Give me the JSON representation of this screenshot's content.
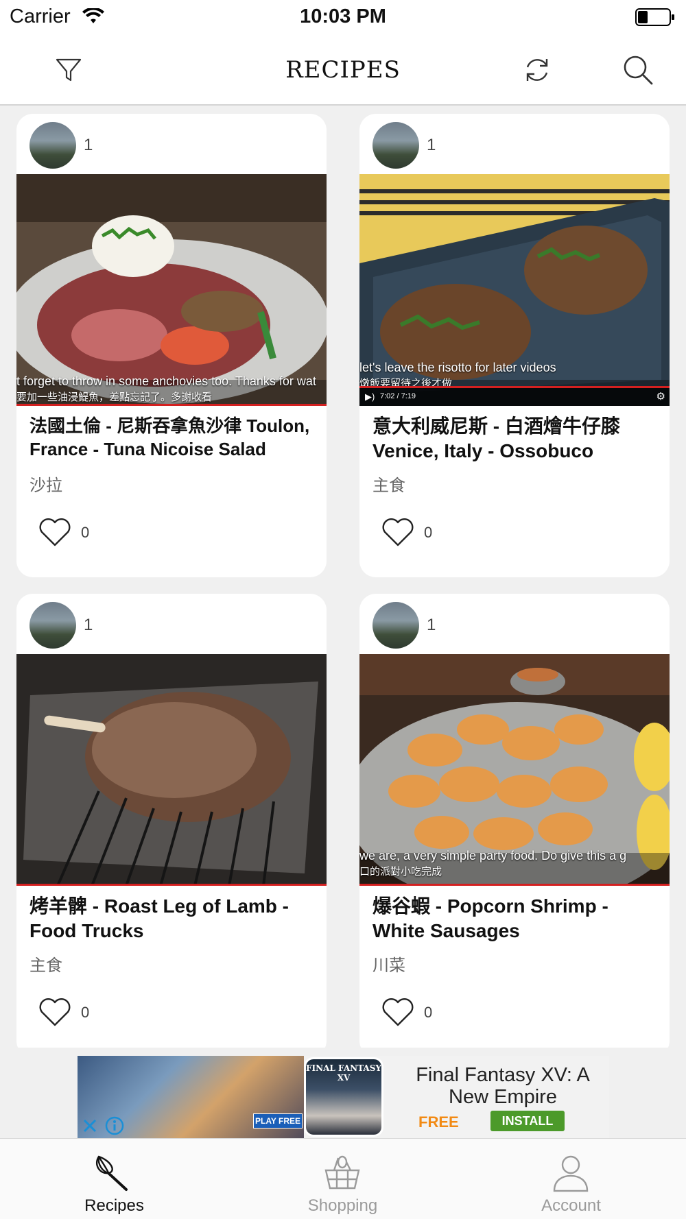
{
  "status_bar": {
    "carrier": "Carrier",
    "time": "10:03 PM"
  },
  "nav": {
    "title": "RECIPES",
    "filter_icon": "filter-icon",
    "refresh_icon": "refresh-icon",
    "search_icon": "search-icon"
  },
  "recipes": [
    {
      "avatar_count": "1",
      "caption_line1": "t forget to throw in some anchovies too. Thanks for wat",
      "caption_line2": "要加一些油浸鯷魚，差點忘記了。多謝收看",
      "title": "法國土倫 - 尼斯吞拿魚沙律 Toulon, France - Tuna Nicoise Salad",
      "category": "沙拉",
      "likes": "0"
    },
    {
      "avatar_count": "1",
      "caption_line1": "let's leave the risotto for later videos",
      "caption_line2": "燉飯要留待之後才做",
      "video_time": "7:02 / 7:19",
      "title": "意大利威尼斯 - 白酒燴牛仔膝 Venice, Italy - Ossobuco",
      "category": "主食",
      "likes": "0"
    },
    {
      "avatar_count": "1",
      "title": "烤羊髀 - Roast Leg of Lamb - Food Trucks",
      "category": "主食",
      "likes": "0"
    },
    {
      "avatar_count": "1",
      "caption_line1": "we are, a very simple party food. Do give this a g",
      "caption_line2": "口的派對小吃完成",
      "title": "爆谷蝦 - Popcorn Shrimp - White Sausages",
      "category": "川菜",
      "likes": "0"
    }
  ],
  "ad": {
    "play_free": "PLAY FREE",
    "logo_text": "FINAL FANTASY XV",
    "headline": "Final Fantasy XV: A New Empire",
    "price": "FREE",
    "install": "INSTALL"
  },
  "tabs": [
    {
      "label": "Recipes",
      "icon": "whisk-icon",
      "active": true
    },
    {
      "label": "Shopping",
      "icon": "basket-icon",
      "active": false
    },
    {
      "label": "Account",
      "icon": "person-icon",
      "active": false
    }
  ],
  "colors": {
    "accent_red": "#d42020",
    "install_green": "#4c9a2a",
    "free_orange": "#f28a14",
    "tab_inactive": "#9a9a9a",
    "tab_active": "#111111"
  }
}
